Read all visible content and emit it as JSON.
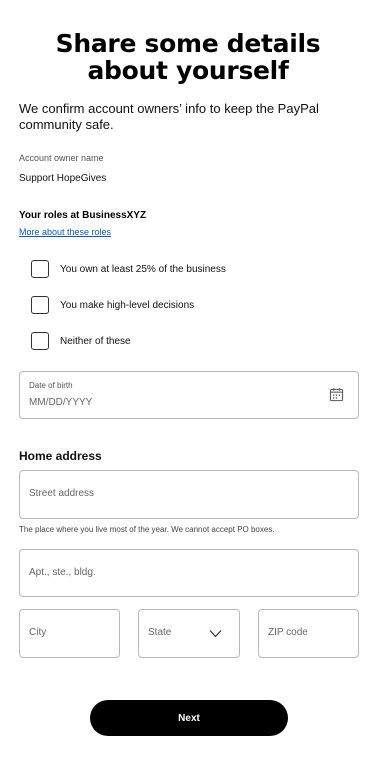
{
  "header": {
    "title": "Share some details about yourself",
    "intro": "We confirm account owners’ info to keep the PayPal community safe."
  },
  "owner": {
    "label": "Account owner name",
    "value": "Support HopeGives"
  },
  "roles": {
    "title": "Your roles at BusinessXYZ",
    "link": "More about these roles",
    "options": [
      {
        "label": "You own at least 25% of the business",
        "checked": false
      },
      {
        "label": "You make high-level decisions",
        "checked": false
      },
      {
        "label": "Neither of these",
        "checked": false
      }
    ]
  },
  "dob": {
    "label": "Date of birth",
    "placeholder": "MM/DD/YYYY",
    "icon": "calendar-icon"
  },
  "address": {
    "title": "Home address",
    "street_placeholder": "Street address",
    "street_hint": "The place where you live most of the year. We cannot accept PO boxes.",
    "apt_placeholder": "Apt., ste., bldg.",
    "city_placeholder": "City",
    "state_placeholder": "State",
    "zip_placeholder": "ZIP code"
  },
  "actions": {
    "next_label": "Next"
  },
  "colors": {
    "link": "#0b57d0",
    "button_bg": "#000000",
    "border": "#b9b9b9"
  }
}
